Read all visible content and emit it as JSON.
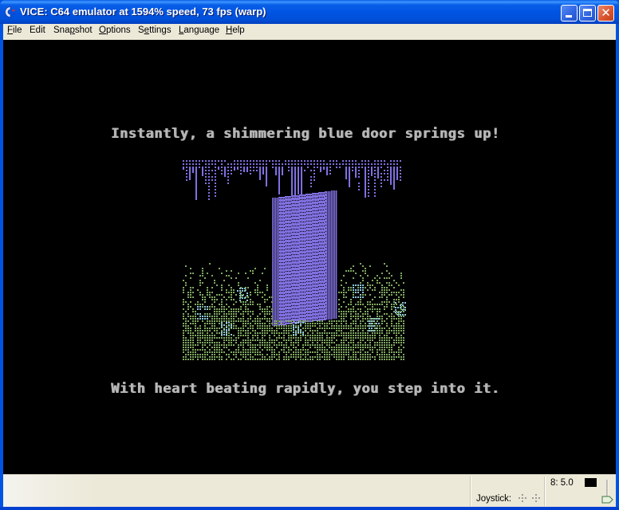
{
  "window": {
    "title": "VICE: C64 emulator at 1594% speed, 73 fps (warp)",
    "controls": {
      "minimize": "minimize",
      "maximize": "maximize",
      "close": "close"
    }
  },
  "menu": {
    "items": [
      {
        "label": "File",
        "mnemonic": "F",
        "rest": "ile"
      },
      {
        "label": "Edit",
        "mnemonic": "",
        "rest": "Edit"
      },
      {
        "label": "Snapshot",
        "pre": "Sna",
        "mnemonic": "p",
        "rest": "shot"
      },
      {
        "label": "Options",
        "mnemonic": "O",
        "rest": "ptions"
      },
      {
        "label": "Settings",
        "pre": "S",
        "mnemonic": "e",
        "rest": "ttings"
      },
      {
        "label": "Language",
        "mnemonic": "L",
        "rest": "anguage"
      },
      {
        "label": "Help",
        "mnemonic": "H",
        "rest": "elp"
      }
    ]
  },
  "screen": {
    "line1": "Instantly, a shimmering blue door springs up!",
    "line2": "With heart beating rapidly, you step into it.",
    "colors": {
      "background": "#000000",
      "text": "#b8b8b8",
      "door": "#8070e0",
      "foliage": "#7fa860",
      "highlight": "#8fc8d8"
    }
  },
  "status": {
    "joystick_label": "Joystick:",
    "drive_label": "8: 5.0",
    "drive_led_color": "#000000"
  }
}
